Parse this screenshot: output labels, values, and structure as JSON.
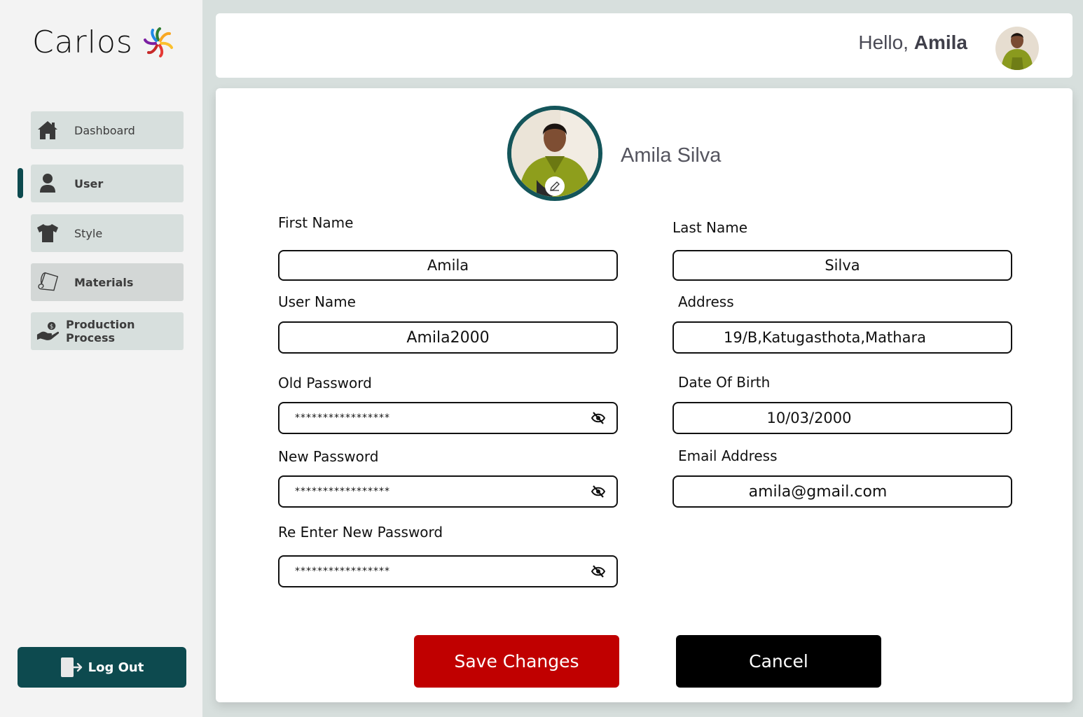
{
  "brand": {
    "name": "Carlos"
  },
  "sidebar": {
    "items": [
      {
        "label": "Dashboard",
        "icon": "home-icon"
      },
      {
        "label": "User",
        "icon": "user-icon"
      },
      {
        "label": "Style",
        "icon": "tshirt-icon"
      },
      {
        "label": "Materials",
        "icon": "fabric-roll-icon"
      },
      {
        "label": "Production Process",
        "icon": "hand-coin-icon"
      }
    ],
    "active": "User",
    "logout_label": "Log Out"
  },
  "header": {
    "greeting_prefix": "Hello,",
    "user_first_name": "Amila"
  },
  "profile": {
    "full_name": "Amila Silva"
  },
  "form": {
    "first_name": {
      "label": "First Name",
      "value": "Amila"
    },
    "last_name": {
      "label": "Last Name",
      "value": "Silva"
    },
    "user_name": {
      "label": "User Name",
      "value": "Amila2000"
    },
    "address": {
      "label": "Address",
      "value": "19/B,Katugasthota,Mathara"
    },
    "old_password": {
      "label": "Old Password",
      "value": "*****************"
    },
    "date_of_birth": {
      "label": "Date Of Birth",
      "value": "10/03/2000"
    },
    "new_password": {
      "label": "New Password",
      "value": "*****************"
    },
    "email": {
      "label": "Email Address",
      "value": "amila@gmail.com"
    },
    "reenter_password": {
      "label": "Re Enter New Password",
      "value": "*****************"
    }
  },
  "actions": {
    "save_label": "Save Changes",
    "cancel_label": "Cancel"
  },
  "colors": {
    "accent": "#0d4a4f",
    "save": "#c00000",
    "cancel": "#000000",
    "nav_bg": "#d7dfdd"
  }
}
